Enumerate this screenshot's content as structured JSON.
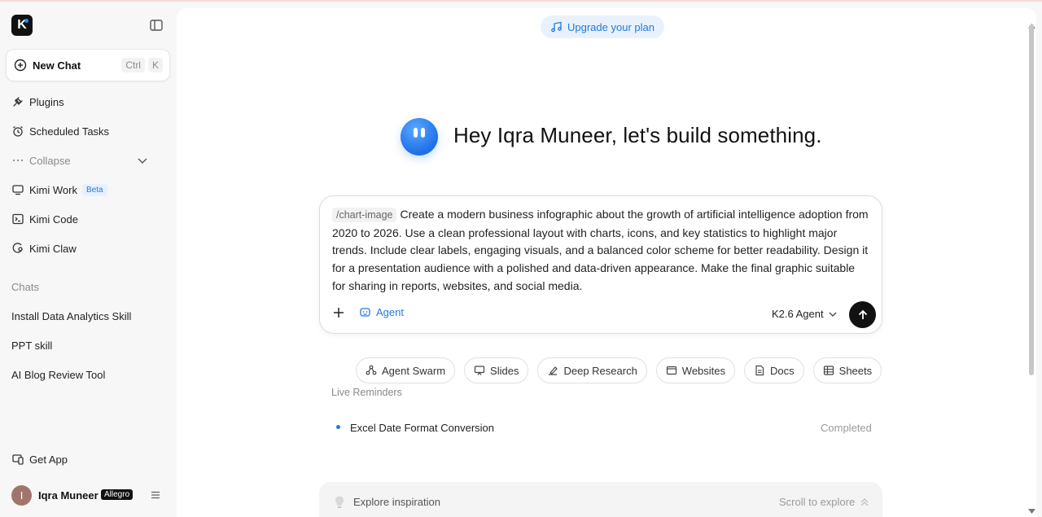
{
  "sidebar": {
    "logo_letter": "K",
    "new_chat_label": "New Chat",
    "shortcut_keys": [
      "Ctrl",
      "K"
    ],
    "items": [
      {
        "label": "Plugins",
        "icon": "plug-icon"
      },
      {
        "label": "Scheduled Tasks",
        "icon": "alarm-clock-icon"
      },
      {
        "label": "Collapse",
        "icon": "more-dots-icon"
      },
      {
        "label": "Kimi Work",
        "icon": "monitor-icon",
        "badge": "Beta"
      },
      {
        "label": "Kimi Code",
        "icon": "terminal-icon"
      },
      {
        "label": "Kimi Claw",
        "icon": "claw-icon"
      }
    ],
    "chats_label": "Chats",
    "chats": [
      "Install Data Analytics Skill",
      "PPT skill",
      "AI Blog Review Tool"
    ],
    "get_app_label": "Get App",
    "user": {
      "initial": "I",
      "name": "Iqra Muneer",
      "plan": "Allegro"
    }
  },
  "main": {
    "upgrade_label": "Upgrade your plan",
    "greeting": "Hey Iqra Muneer, let's build something.",
    "composer": {
      "command_chip": "/chart-image",
      "prompt_text": "Create a modern business infographic about the growth of artificial intelligence adoption from 2020 to 2026. Use a clean professional layout with charts, icons, and key statistics to highlight major trends. Include clear labels, engaging visuals, and a balanced color scheme for better readability. Design it for a presentation audience with a polished and data-driven appearance. Make the final graphic suitable for sharing in reports, websites, and social media.",
      "agent_label": "Agent",
      "model_label": "K2.6 Agent"
    },
    "tools": [
      "Agent Swarm",
      "Slides",
      "Deep Research",
      "Websites",
      "Docs",
      "Sheets"
    ],
    "live_reminders_label": "Live Reminders",
    "reminder": {
      "title": "Excel Date Format Conversion",
      "status": "Completed"
    },
    "explore_label": "Explore inspiration",
    "scroll_label": "Scroll to explore"
  },
  "colors": {
    "accent": "#1f7ae0",
    "send_button": "#111111",
    "mascot": "#1e6fe8"
  }
}
